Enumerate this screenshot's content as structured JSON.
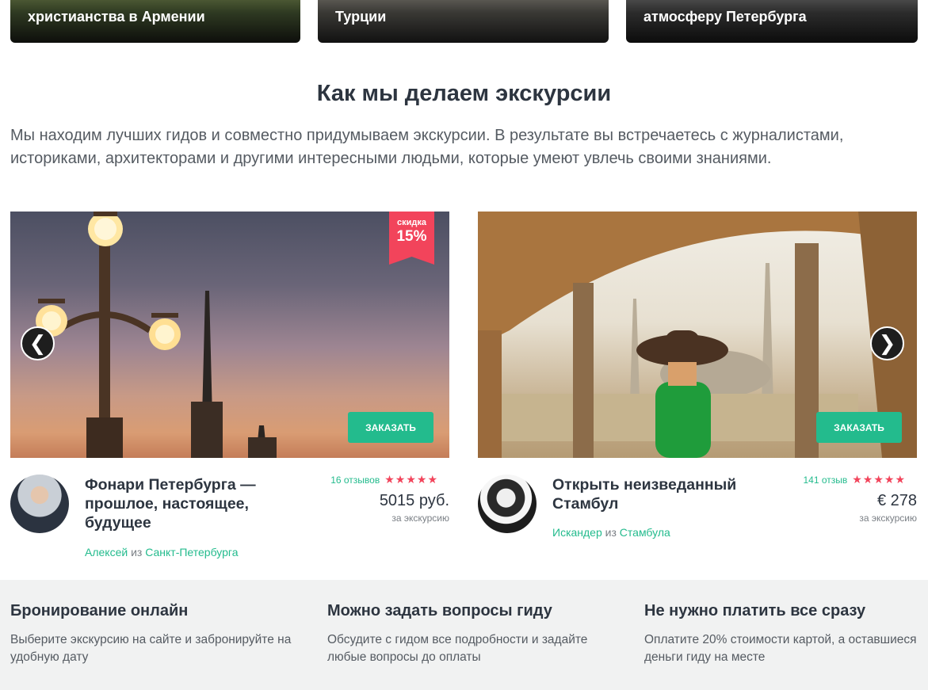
{
  "top_cards": [
    {
      "text": "христианства в Армении"
    },
    {
      "text": "Турции"
    },
    {
      "text": "атмосферу Петербурга"
    }
  ],
  "section": {
    "title": "Как мы делаем экскурсии",
    "description": "Мы находим лучших гидов и совместно придумываем экскурсии. В результате вы встречаетесь с журналистами, историками, архитекторами и другими интересными людьми, которые умеют увлечь своими знаниями."
  },
  "tours": [
    {
      "discount_label": "скидка",
      "discount_value": "15%",
      "order_label": "ЗАКАЗАТЬ",
      "title": "Фонари Петербурга — прошлое, настоящее, будущее",
      "reviews": "16 отзывов",
      "stars": "★★★★★",
      "price": "5015 руб.",
      "per": "за экскурсию",
      "guide_name": "Алексей",
      "from_word": " из ",
      "guide_city": "Санкт-Петербурга"
    },
    {
      "order_label": "ЗАКАЗАТЬ",
      "title": "Открыть неизведанный Стамбул",
      "reviews": "141 отзыв",
      "stars": "★★★★★",
      "price": "€ 278",
      "per": "за экскурсию",
      "guide_name": "Искандер",
      "from_word": " из ",
      "guide_city": "Стамбула"
    }
  ],
  "carousel": {
    "prev": "❮",
    "next": "❯"
  },
  "features": [
    {
      "title": "Бронирование онлайн",
      "text": "Выберите экскурсию на сайте и забронируйте на удобную дату"
    },
    {
      "title": "Можно задать вопросы гиду",
      "text": "Обсудите с гидом все подробности и задайте любые вопросы до оплаты"
    },
    {
      "title": "Не нужно платить все сразу",
      "text": "Оплатите 20% стоимости картой, а оставшиеся деньги гиду на месте"
    }
  ]
}
